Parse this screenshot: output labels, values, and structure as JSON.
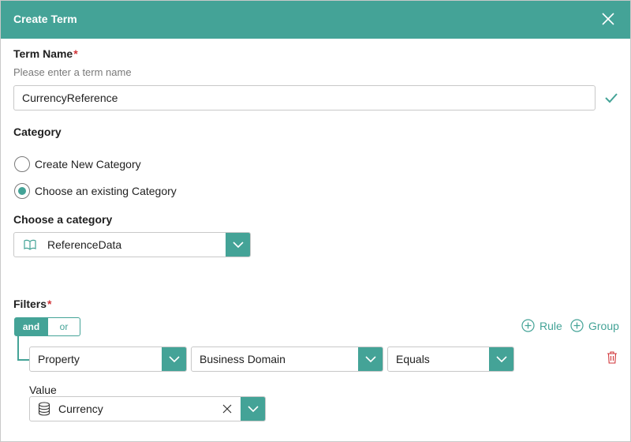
{
  "dialog": {
    "title": "Create Term",
    "close_icon": "close-icon"
  },
  "term_name": {
    "label": "Term Name",
    "required_mark": "*",
    "hint": "Please enter a term name",
    "value": "CurrencyReference",
    "valid_icon": "checkmark-icon"
  },
  "category": {
    "label": "Category",
    "options": [
      {
        "label": "Create New Category",
        "checked": false
      },
      {
        "label": "Choose an existing Category",
        "checked": true
      }
    ]
  },
  "choose_category": {
    "label": "Choose a category",
    "selected": "ReferenceData",
    "icon": "book-icon"
  },
  "filters": {
    "label": "Filters",
    "required_mark": "*",
    "logic": {
      "and_label": "and",
      "or_label": "or",
      "selected": "and"
    },
    "add_rule_label": "Rule",
    "add_group_label": "Group",
    "rule": {
      "field": "Property",
      "property": "Business Domain",
      "operator": "Equals",
      "value_label": "Value",
      "value": "Currency",
      "value_icon": "database-icon"
    }
  },
  "colors": {
    "accent": "#44a397",
    "required": "#d13438",
    "danger": "#d13438"
  }
}
